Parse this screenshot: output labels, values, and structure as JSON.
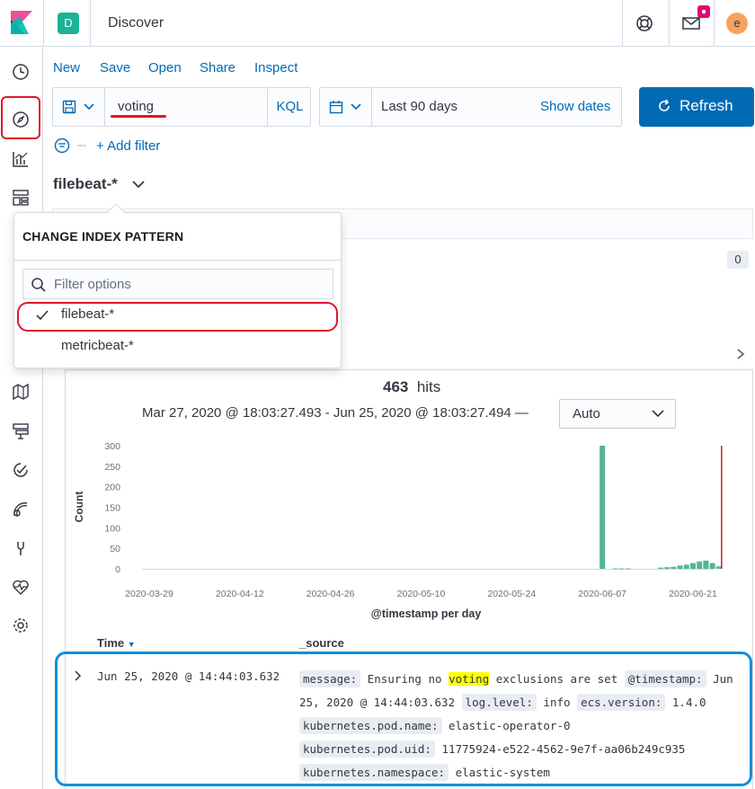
{
  "header": {
    "space_initial": "D",
    "app_title": "Discover",
    "avatar_initial": "e",
    "icons": [
      "kibana-logo",
      "help-lifebuoy-icon",
      "mail-icon",
      "notification-dot"
    ]
  },
  "sidenav": {
    "items": [
      "recent-clock-icon",
      "discover-compass-icon",
      "visualize-chart-icon",
      "dashboard-icon",
      "maps-icon",
      "ml-icon",
      "uptime-icon",
      "siem-icon",
      "dev-tools-icon",
      "monitoring-icon",
      "management-gear-icon"
    ]
  },
  "topnav": {
    "new": "New",
    "save": "Save",
    "open": "Open",
    "share": "Share",
    "inspect": "Inspect"
  },
  "query": {
    "value": "voting",
    "language": "KQL"
  },
  "date": {
    "range": "Last 90 days",
    "show_dates": "Show dates"
  },
  "refresh": {
    "label": "Refresh"
  },
  "filter": {
    "add_label": "+ Add filter"
  },
  "index_pattern": {
    "current": "filebeat-*"
  },
  "popover": {
    "title": "CHANGE INDEX PATTERN",
    "search_placeholder": "Filter options",
    "options": [
      "filebeat-*",
      "metricbeat-*"
    ],
    "selected": "filebeat-*"
  },
  "field_count": "0",
  "results": {
    "hits_count": "463",
    "hits_label": "hits",
    "range_text": "Mar 27, 2020 @ 18:03:27.493 - Jun 25, 2020 @ 18:03:27.494 —",
    "interval": "Auto"
  },
  "chart_data": {
    "type": "bar",
    "xlabel": "@timestamp per day",
    "ylabel": "Count",
    "ylim": [
      0,
      300
    ],
    "yticks": [
      "0",
      "50",
      "100",
      "150",
      "200",
      "250",
      "300"
    ],
    "xticks": [
      "2020-03-29",
      "2020-04-12",
      "2020-04-26",
      "2020-05-10",
      "2020-05-24",
      "2020-06-07",
      "2020-06-21"
    ],
    "series": [
      {
        "x": [
          "2020-06-07",
          "2020-06-09",
          "2020-06-10",
          "2020-06-11",
          "2020-06-16",
          "2020-06-17",
          "2020-06-18",
          "2020-06-19",
          "2020-06-20",
          "2020-06-21",
          "2020-06-22",
          "2020-06-23",
          "2020-06-24",
          "2020-06-25"
        ],
        "values": [
          300,
          1,
          1,
          1,
          3,
          4,
          5,
          8,
          10,
          14,
          18,
          20,
          14,
          6
        ]
      }
    ],
    "color": "#54b399",
    "now_marker": "2020-06-25",
    "now_color": "#bd271e"
  },
  "table": {
    "col_time": "Time",
    "col_source": "_source",
    "row": {
      "time": "Jun 25, 2020 @ 14:44:03.632",
      "fields": [
        {
          "k": "message:",
          "pre": "Ensuring no",
          "hl": "voting",
          "post": "exclusions are set"
        },
        {
          "k": "@timestamp:",
          "v": "Jun 25, 2020 @ 14:44:03.632"
        },
        {
          "k": "log.level:",
          "v": "info"
        },
        {
          "k": "ecs.version:",
          "v": "1.4.0"
        },
        {
          "k": "kubernetes.pod.name:",
          "v": "elastic-operator-0"
        },
        {
          "k": "kubernetes.pod.uid:",
          "v": "11775924-e522-4562-9e7f-aa06b249c935"
        },
        {
          "k": "kubernetes.namespace:",
          "v": "elastic-system"
        }
      ]
    }
  }
}
